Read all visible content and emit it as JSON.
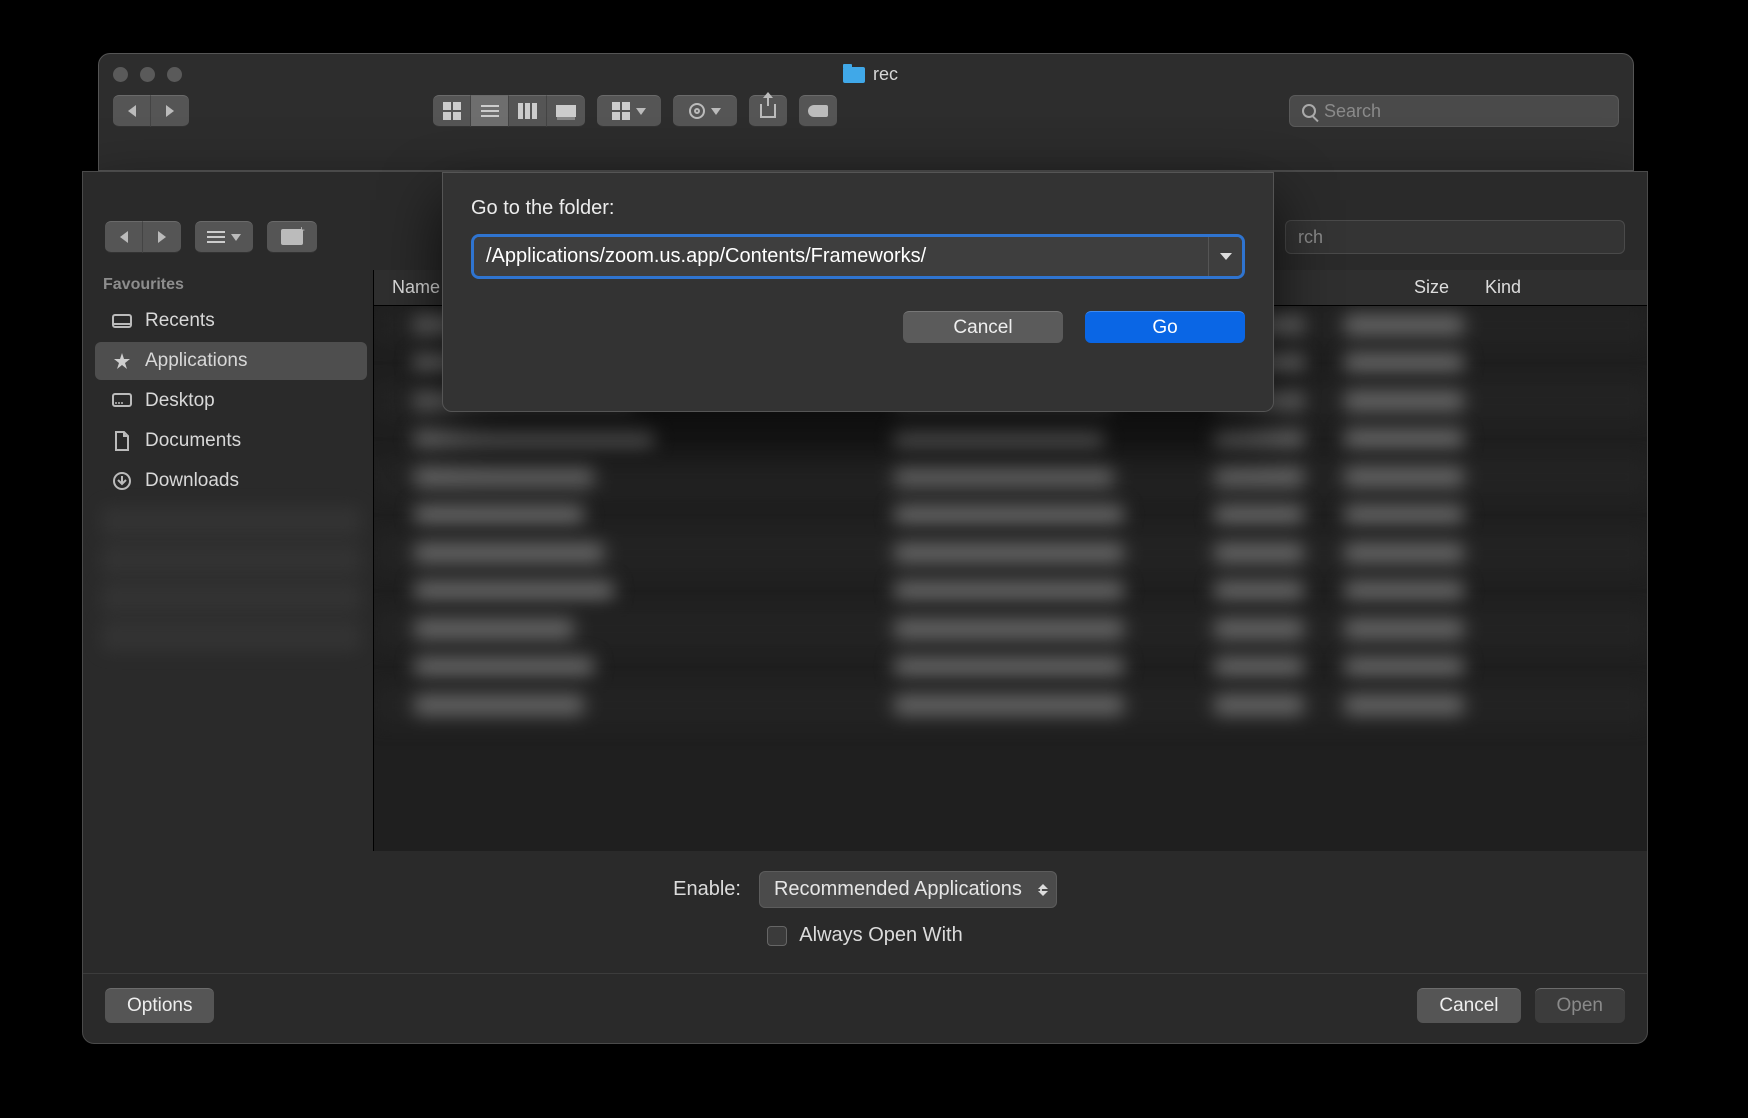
{
  "finder": {
    "title": "rec",
    "search_placeholder": "Search"
  },
  "sheet": {
    "search_placeholder": "rch",
    "sidebar_heading": "Favourites",
    "sidebar": [
      {
        "label": "Recents"
      },
      {
        "label": "Applications"
      },
      {
        "label": "Desktop"
      },
      {
        "label": "Documents"
      },
      {
        "label": "Downloads"
      }
    ],
    "columns": {
      "name": "Name",
      "date": "",
      "size": "Size",
      "kind": "Kind"
    },
    "enable_label": "Enable:",
    "enable_value": "Recommended Applications",
    "always_open_label": "Always Open With",
    "options_label": "Options",
    "cancel_label": "Cancel",
    "open_label": "Open"
  },
  "goto": {
    "prompt": "Go to the folder:",
    "path": "/Applications/zoom.us.app/Contents/Frameworks/",
    "cancel": "Cancel",
    "go": "Go"
  }
}
